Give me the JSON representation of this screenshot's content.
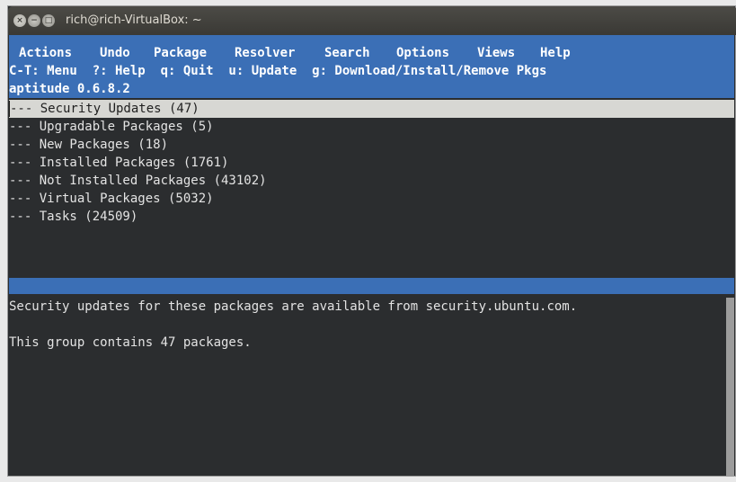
{
  "window": {
    "title": "rich@rich-VirtualBox: ~",
    "buttons": {
      "close": "×",
      "minimize": "−",
      "maximize": "□"
    }
  },
  "menubar": {
    "items": [
      "Actions",
      "Undo",
      "Package",
      "Resolver",
      "Search",
      "Options",
      "Views",
      "Help"
    ]
  },
  "hint_line": "C-T: Menu  ?: Help  q: Quit  u: Update  g: Download/Install/Remove Pkgs",
  "version_line": "aptitude 0.6.8.2",
  "tree": {
    "items": [
      {
        "prefix": "--- ",
        "label": "Security Updates (47)",
        "selected": true
      },
      {
        "prefix": "--- ",
        "label": "Upgradable Packages (5)",
        "selected": false
      },
      {
        "prefix": "--- ",
        "label": "New Packages (18)",
        "selected": false
      },
      {
        "prefix": "--- ",
        "label": "Installed Packages (1761)",
        "selected": false
      },
      {
        "prefix": "--- ",
        "label": "Not Installed Packages (43102)",
        "selected": false
      },
      {
        "prefix": "--- ",
        "label": "Virtual Packages (5032)",
        "selected": false
      },
      {
        "prefix": "--- ",
        "label": "Tasks (24509)",
        "selected": false
      }
    ]
  },
  "description": {
    "line1": "Security updates for these packages are available from security.ubuntu.com.",
    "line2": "This group contains 47 packages."
  }
}
